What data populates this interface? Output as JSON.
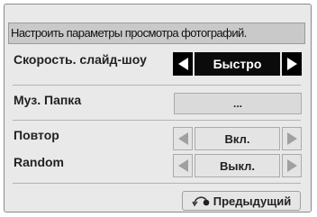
{
  "header": {
    "title": "Настроить параметры просмотра фотографий."
  },
  "rows": [
    {
      "label": "Скорость. слайд-шоу",
      "value": "Быстро"
    },
    {
      "label": "Муз. Папка",
      "value": "..."
    },
    {
      "label": "Повтор",
      "value": "Вкл."
    },
    {
      "label": "Random",
      "value": "Выкл."
    }
  ],
  "footer": {
    "prev_label": "Предыдущий"
  },
  "icons": {
    "left": "triangle-left-icon",
    "right": "triangle-right-icon",
    "back": "return-arrow-icon"
  }
}
